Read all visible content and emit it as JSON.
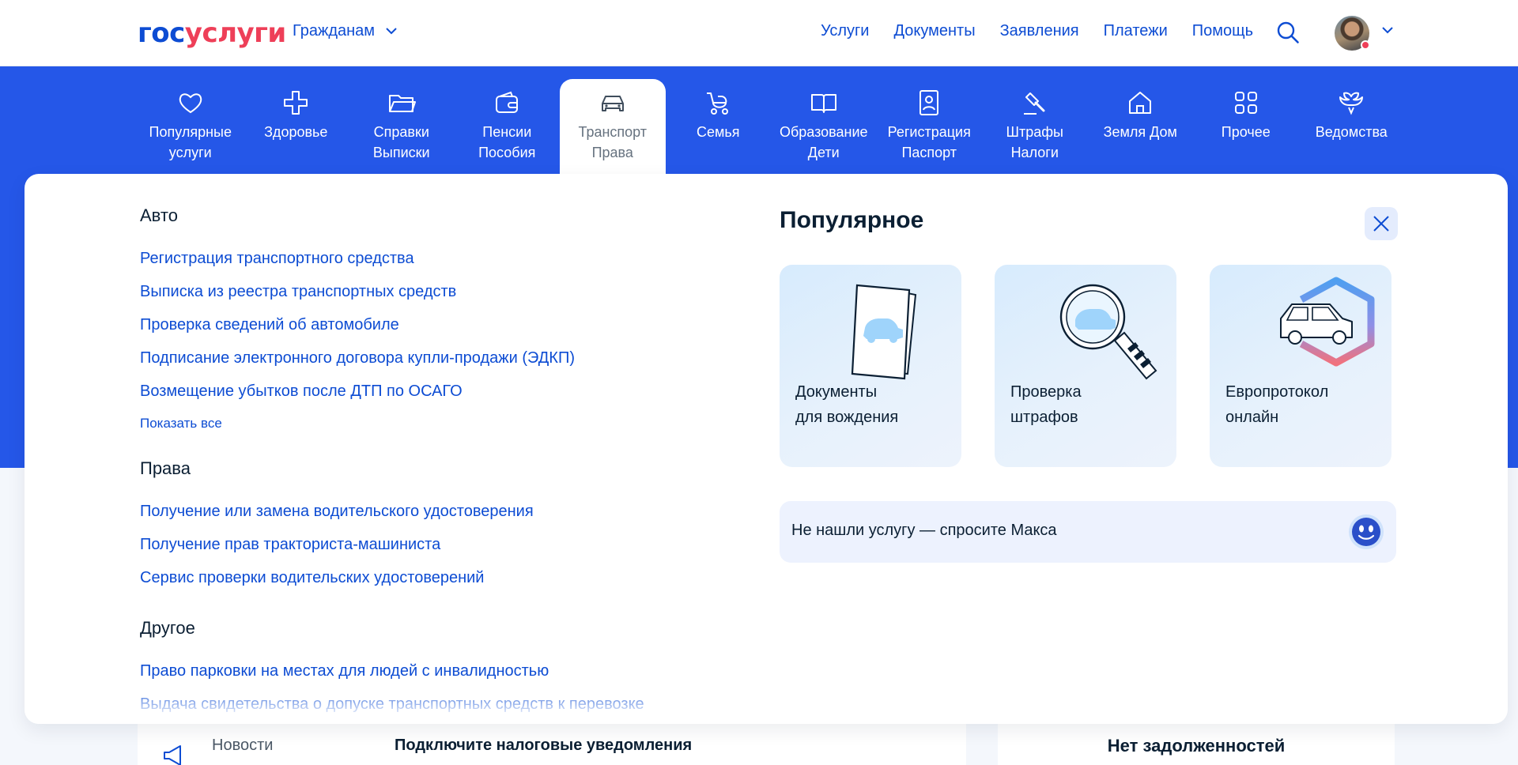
{
  "header": {
    "logo_part1": "гос",
    "logo_part2": "услуги",
    "audience": "Гражданам",
    "nav": [
      "Услуги",
      "Документы",
      "Заявления",
      "Платежи",
      "Помощь"
    ]
  },
  "categories": [
    {
      "label": "Популярные\nуслуги",
      "icon": "heart-icon"
    },
    {
      "label": "Здоровье",
      "icon": "cross-icon"
    },
    {
      "label": "Справки\nВыписки",
      "icon": "folder-icon"
    },
    {
      "label": "Пенсии\nПособия",
      "icon": "wallet-icon"
    },
    {
      "label": "Транспорт\nПрава",
      "icon": "car-icon",
      "active": true
    },
    {
      "label": "Семья",
      "icon": "stroller-icon"
    },
    {
      "label": "Образование\nДети",
      "icon": "book-icon"
    },
    {
      "label": "Регистрация\nПаспорт",
      "icon": "id-card-icon"
    },
    {
      "label": "Штрафы\nНалоги",
      "icon": "gavel-icon"
    },
    {
      "label": "Земля Дом",
      "icon": "house-icon"
    },
    {
      "label": "Прочее",
      "icon": "grid-icon"
    },
    {
      "label": "Ведомства",
      "icon": "eagle-icon"
    }
  ],
  "panel": {
    "groups": [
      {
        "title": "Авто",
        "links": [
          "Регистрация транспортного средства",
          "Выписка из реестра транспортных средств",
          "Проверка сведений об автомобиле",
          "Подписание электронного договора купли-продажи (ЭДКП)",
          "Возмещение убытков после ДТП по ОСАГО"
        ],
        "show_all": "Показать все"
      },
      {
        "title": "Права",
        "links": [
          "Получение или замена водительского удостоверения",
          "Получение прав тракториста-машиниста",
          "Сервис проверки водительских удостоверений"
        ]
      },
      {
        "title": "Другое",
        "links": [
          "Право парковки на местах для людей с инвалидностью",
          "Выдача свидетельства о допуске транспортных средств к перевозке"
        ]
      }
    ],
    "popular_title": "Популярное",
    "cards": [
      {
        "label": "Документы\nдля вождения",
        "icon": "document-car-icon"
      },
      {
        "label": "Проверка\nштрафов",
        "icon": "magnifier-car-icon"
      },
      {
        "label": "Европротокол\nонлайн",
        "icon": "car-hexagon-icon"
      }
    ],
    "ask": "Не нашли услугу — спросите Макса"
  },
  "background": {
    "news_label": "Новости",
    "news_text": "Подключите налоговые уведомления",
    "debt": "Нет задолженностей"
  },
  "colors": {
    "accent": "#0d4cd3",
    "brand_red": "#ee3f58",
    "band": "#2557e8"
  }
}
